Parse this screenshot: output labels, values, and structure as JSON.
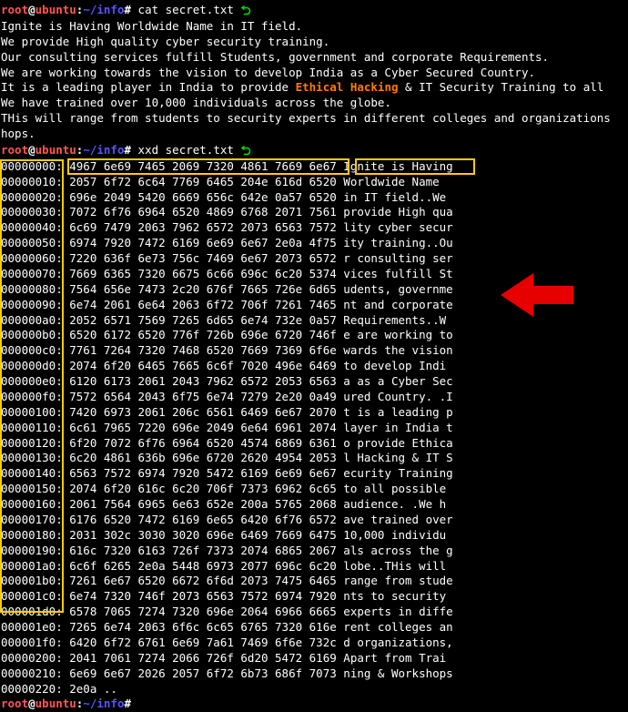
{
  "prompt": {
    "user": "root",
    "host": "ubuntu",
    "path": "~/info",
    "sym": "#"
  },
  "cmd1": "cat secret.txt",
  "cat_output": [
    {
      "plain_all": "Ignite is Having Worldwide Name in IT field."
    },
    {
      "plain_all": "We provide High quality cyber security training."
    },
    {
      "plain_all": "Our consulting services fulfill Students, government and corporate Requirements."
    },
    {
      "plain_all": "We are working towards the vision to develop India as a Cyber Secured Country."
    },
    {
      "pre": "It is a leading player in India to provide ",
      "kw": "Ethical Hacking",
      "post": " & IT Security Training to all"
    },
    {
      "plain_all": "We have trained over 10,000 individuals across the globe."
    },
    {
      "plain_all": "THis will range from students to security experts in different colleges and organizations"
    },
    {
      "plain_all": "hops."
    }
  ],
  "cmd2": "xxd secret.txt",
  "hex": [
    {
      "o": "00000000:",
      "b": "4967 6e69 7465 2069 7320 4861 7669 6e67",
      "a": "Ignite is Having"
    },
    {
      "o": "00000010:",
      "b": "2057 6f72 6c64 7769 6465 204e 616d 6520",
      "a": " Worldwide Name "
    },
    {
      "o": "00000020:",
      "b": "696e 2049 5420 6669 656c 642e 0a57 6520",
      "a": "in IT field..We "
    },
    {
      "o": "00000030:",
      "b": "7072 6f76 6964 6520 4869 6768 2071 7561",
      "a": "provide High qua"
    },
    {
      "o": "00000040:",
      "b": "6c69 7479 2063 7962 6572 2073 6563 7572",
      "a": "lity cyber secur"
    },
    {
      "o": "00000050:",
      "b": "6974 7920 7472 6169 6e69 6e67 2e0a 4f75",
      "a": "ity training..Ou"
    },
    {
      "o": "00000060:",
      "b": "7220 636f 6e73 756c 7469 6e67 2073 6572",
      "a": "r consulting ser"
    },
    {
      "o": "00000070:",
      "b": "7669 6365 7320 6675 6c66 696c 6c20 5374",
      "a": "vices fulfill St"
    },
    {
      "o": "00000080:",
      "b": "7564 656e 7473 2c20 676f 7665 726e 6d65",
      "a": "udents, governme"
    },
    {
      "o": "00000090:",
      "b": "6e74 2061 6e64 2063 6f72 706f 7261 7465",
      "a": "nt and corporate"
    },
    {
      "o": "000000a0:",
      "b": "2052 6571 7569 7265 6d65 6e74 732e 0a57",
      "a": " Requirements..W"
    },
    {
      "o": "000000b0:",
      "b": "6520 6172 6520 776f 726b 696e 6720 746f",
      "a": "e are working to"
    },
    {
      "o": "000000c0:",
      "b": "7761 7264 7320 7468 6520 7669 7369 6f6e",
      "a": "wards the vision"
    },
    {
      "o": "000000d0:",
      "b": "2074 6f20 6465 7665 6c6f 7020 496e 6469",
      "a": " to develop Indi"
    },
    {
      "o": "000000e0:",
      "b": "6120 6173 2061 2043 7962 6572 2053 6563",
      "a": "a as a Cyber Sec"
    },
    {
      "o": "000000f0:",
      "b": "7572 6564 2043 6f75 6e74 7279 2e20 0a49",
      "a": "ured Country. .I"
    },
    {
      "o": "00000100:",
      "b": "7420 6973 2061 206c 6561 6469 6e67 2070",
      "a": "t is a leading p"
    },
    {
      "o": "00000110:",
      "b": "6c61 7965 7220 696e 2049 6e64 6961 2074",
      "a": "layer in India t"
    },
    {
      "o": "00000120:",
      "b": "6f20 7072 6f76 6964 6520 4574 6869 6361",
      "a": "o provide Ethica"
    },
    {
      "o": "00000130:",
      "b": "6c20 4861 636b 696e 6720 2620 4954 2053",
      "a": "l Hacking & IT S"
    },
    {
      "o": "00000140:",
      "b": "6563 7572 6974 7920 5472 6169 6e69 6e67",
      "a": "ecurity Training"
    },
    {
      "o": "00000150:",
      "b": "2074 6f20 616c 6c20 706f 7373 6962 6c65",
      "a": " to all possible"
    },
    {
      "o": "00000160:",
      "b": "2061 7564 6965 6e63 652e 200a 5765 2068",
      "a": " audience. .We h"
    },
    {
      "o": "00000170:",
      "b": "6176 6520 7472 6169 6e65 6420 6f76 6572",
      "a": "ave trained over"
    },
    {
      "o": "00000180:",
      "b": "2031 302c 3030 3020 696e 6469 7669 6475",
      "a": " 10,000 individu"
    },
    {
      "o": "00000190:",
      "b": "616c 7320 6163 726f 7373 2074 6865 2067",
      "a": "als across the g"
    },
    {
      "o": "000001a0:",
      "b": "6c6f 6265 2e0a 5448 6973 2077 696c 6c20",
      "a": "lobe..THis will "
    },
    {
      "o": "000001b0:",
      "b": "7261 6e67 6520 6672 6f6d 2073 7475 6465",
      "a": "range from stude"
    },
    {
      "o": "000001c0:",
      "b": "6e74 7320 746f 2073 6563 7572 6974 7920",
      "a": "nts to security "
    },
    {
      "o": "000001d0:",
      "b": "6578 7065 7274 7320 696e 2064 6966 6665",
      "a": "experts in diffe"
    },
    {
      "o": "000001e0:",
      "b": "7265 6e74 2063 6f6c 6c65 6765 7320 616e",
      "a": "rent colleges an"
    },
    {
      "o": "000001f0:",
      "b": "6420 6f72 6761 6e69 7a61 7469 6f6e 732c",
      "a": "d organizations,"
    },
    {
      "o": "00000200:",
      "b": "2041 7061 7274 2066 726f 6d20 5472 6169",
      "a": " Apart from Trai"
    },
    {
      "o": "00000210:",
      "b": "6e69 6e67 2026 2057 6f72 6b73 686f 7073",
      "a": "ning & Workshops"
    },
    {
      "o": "00000220:",
      "b": "2e0a                                   ",
      "a": ".."
    }
  ]
}
